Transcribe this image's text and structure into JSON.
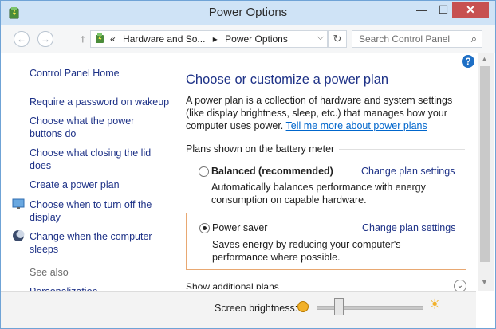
{
  "window": {
    "title": "Power Options",
    "minimize": "—",
    "maximize": "☐",
    "close": "✕"
  },
  "nav": {
    "back": "←",
    "forward": "→",
    "up": "↑",
    "breadcrumb": [
      "«",
      "Hardware and So...",
      "▸",
      "Power Options"
    ],
    "dropdown": "⌵",
    "refresh": "↻",
    "search_placeholder": "Search Control Panel",
    "search_icon": "⌕"
  },
  "help": "?",
  "sidebar": {
    "home": "Control Panel Home",
    "links": [
      "Require a password on wakeup",
      "Choose what the power buttons do",
      "Choose what closing the lid does",
      "Create a power plan",
      "Choose when to turn off the display",
      "Change when the computer sleeps"
    ],
    "see_also": "See also",
    "personalization": "Personalization"
  },
  "main": {
    "heading": "Choose or customize a power plan",
    "desc": "A power plan is a collection of hardware and system settings (like display brightness, sleep, etc.) that manages how your computer uses power.",
    "desc_link": "Tell me more about power plans",
    "plans_header": "Plans shown on the battery meter",
    "plans": [
      {
        "name": "Balanced (recommended)",
        "link": "Change plan settings",
        "desc": "Automatically balances performance with energy consumption on capable hardware.",
        "selected": false
      },
      {
        "name": "Power saver",
        "link": "Change plan settings",
        "desc": "Saves energy by reducing your computer's performance where possible.",
        "selected": true
      }
    ],
    "show_additional": "Show additional plans",
    "show_additional_icon": "⌄"
  },
  "brightness": {
    "label": "Screen brightness:",
    "level": 0.18,
    "max_icon": "☀"
  },
  "scroll": {
    "up": "▲",
    "down": "▼"
  }
}
